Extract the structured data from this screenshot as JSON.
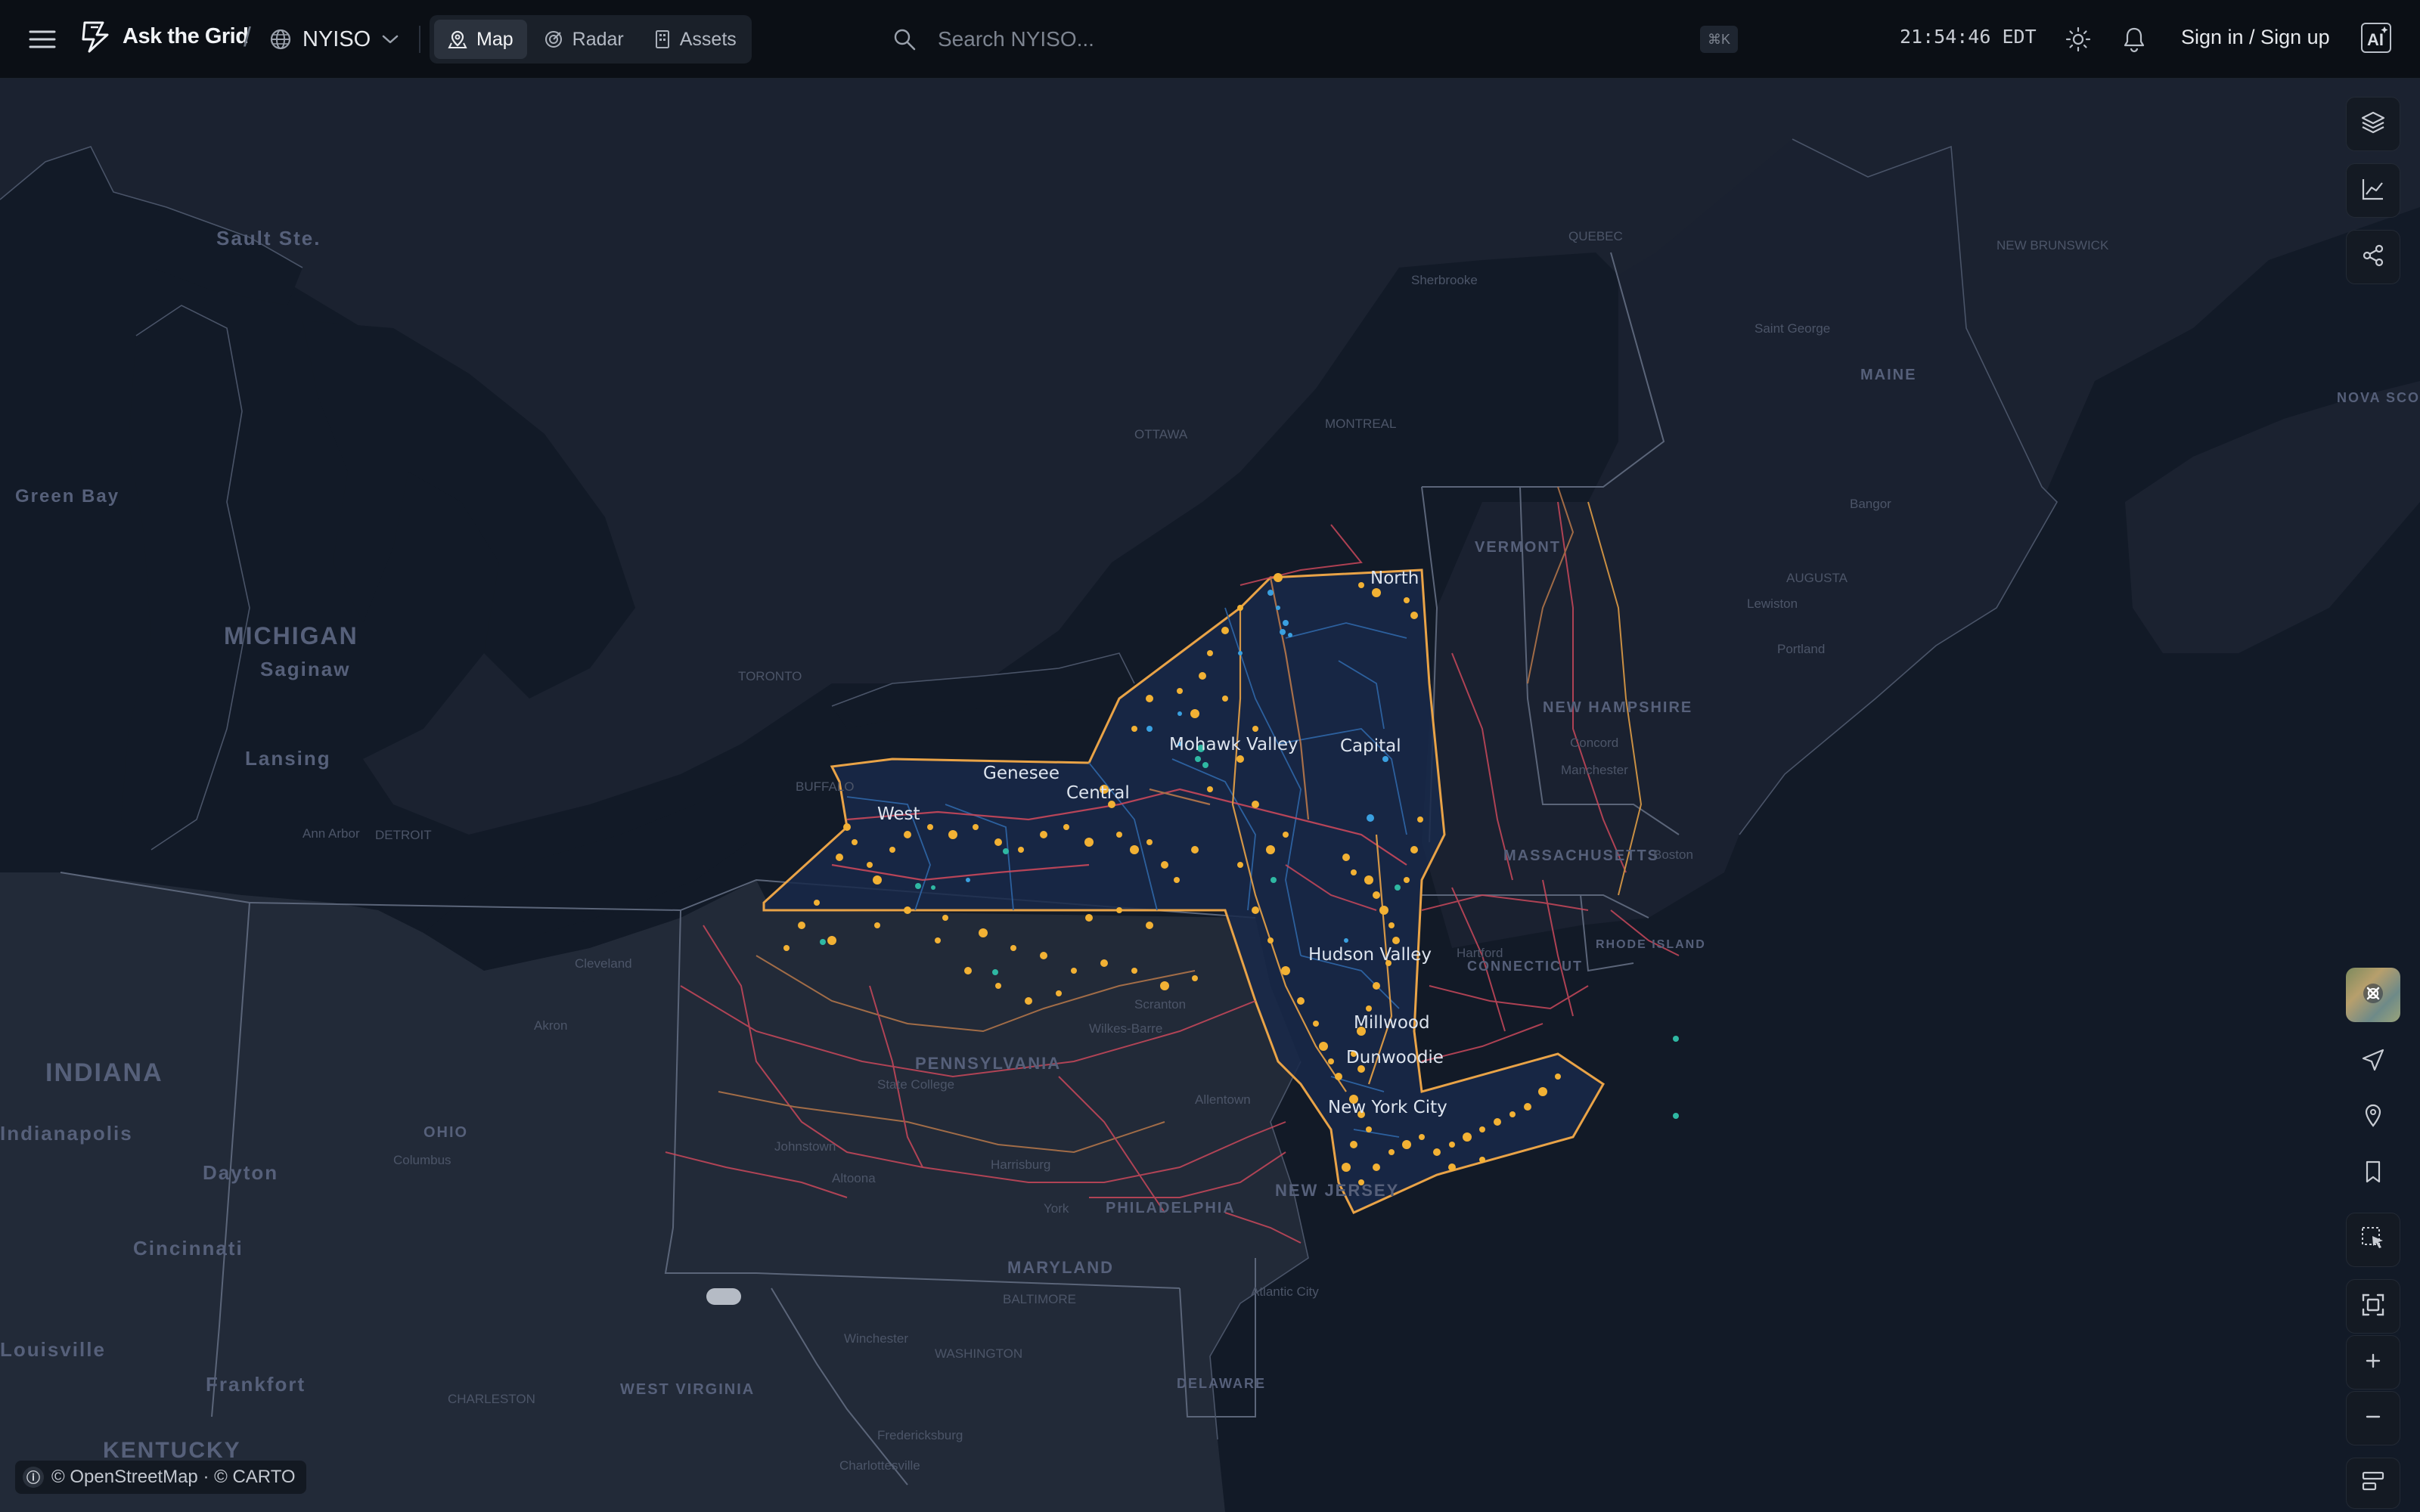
{
  "header": {
    "brand": "Ask the Grid",
    "region": "NYISO",
    "tabs": [
      {
        "label": "Map",
        "active": true
      },
      {
        "label": "Radar",
        "active": false
      },
      {
        "label": "Assets",
        "active": false
      }
    ],
    "search_placeholder": "Search NYISO...",
    "search_shortcut": "⌘K",
    "clock": "21:54:46 EDT",
    "signin": "Sign in / Sign up"
  },
  "map": {
    "zones": [
      "North",
      "Genesee",
      "West",
      "Central",
      "Mohawk Valley",
      "Capital",
      "Hudson Valley",
      "Millwood",
      "Dunwoodie",
      "New York City"
    ],
    "places": [
      "Sault Ste.",
      "Green Bay",
      "MICHIGAN",
      "Saginaw",
      "Lansing",
      "DETROIT",
      "Ann Arbor",
      "TORONTO",
      "BUFFALO",
      "OTTAWA",
      "MONTREAL",
      "QUEBEC",
      "Sherbrooke",
      "NEW BRUNSWICK",
      "Saint George",
      "MAINE",
      "Bangor",
      "AUGUSTA",
      "NOVA SCOTIA",
      "Lewiston",
      "Portland",
      "VERMONT",
      "NEW HAMPSHIRE",
      "Concord",
      "Manchester",
      "MASSACHUSETTS",
      "Boston",
      "CONNECTICUT",
      "Hartford",
      "RHODE ISLAND",
      "NEW JERSEY",
      "PENNSYLVANIA",
      "PHILADELPHIA",
      "Harrisburg",
      "Scranton",
      "Wilkes-Barre",
      "Allentown",
      "York",
      "State College",
      "Johnstown",
      "Altoona",
      "OHIO",
      "Columbus",
      "Akron",
      "Cleveland",
      "Dayton",
      "Cincinnati",
      "INDIANA",
      "Indianapolis",
      "Louisville",
      "Frankfort",
      "KENTUCKY",
      "WEST VIRGINIA",
      "CHARLESTON",
      "MARYLAND",
      "BALTIMORE",
      "WASHINGTON",
      "Atlantic City",
      "DELAWARE",
      "Fredericksburg",
      "Charlottesville",
      "Winchester"
    ],
    "colors": {
      "nyiso_boundary": "#e9a347",
      "generator": "#f2b134",
      "battery": "#2fb8a3",
      "hydro": "#3aa0e0",
      "transmission": "#c9485b",
      "transmission_minor": "#b8784a",
      "zone_line": "#2f67a8",
      "state_border": "#5b6579"
    }
  },
  "attribution": "ⓘ",
  "attribution_text": "© OpenStreetMap · © CARTO",
  "controls": {
    "top": [
      "layers-icon",
      "chart-icon",
      "share-icon"
    ],
    "bottom": [
      "basemap-icon",
      "locate-icon",
      "pin-icon",
      "bookmark-icon",
      "select-icon",
      "fit-icon",
      "plus-icon",
      "minus-icon",
      "legend-icon"
    ]
  }
}
